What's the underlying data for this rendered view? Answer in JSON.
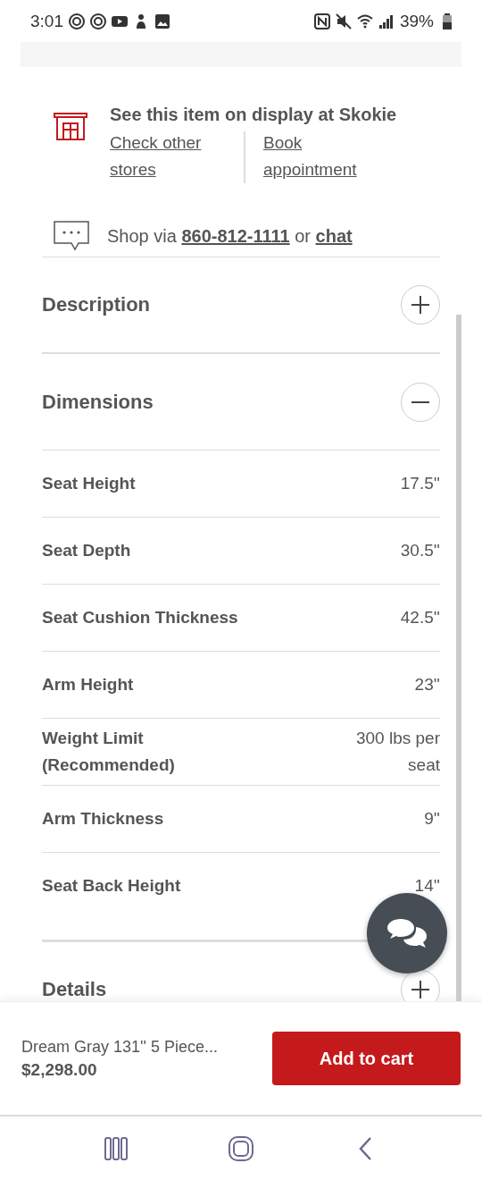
{
  "status_bar": {
    "time": "3:01",
    "battery": "39%"
  },
  "store": {
    "title": "See this item on display at Skokie",
    "links": [
      "Check other stores",
      "Book appointment"
    ]
  },
  "contact": {
    "prefix": "Shop via",
    "phone": "860-812-1111",
    "joiner": "or",
    "chat": "chat"
  },
  "sections": [
    {
      "title": "Description",
      "expanded": false
    },
    {
      "title": "Dimensions",
      "expanded": true,
      "rows": [
        {
          "label": "Seat Height",
          "value": "17.5''"
        },
        {
          "label": "Seat Depth",
          "value": "30.5''"
        },
        {
          "label": "Seat Cushion Thickness",
          "value": "42.5''"
        },
        {
          "label": "Arm Height",
          "value": "23''"
        },
        {
          "label": "Weight Limit (Recommended)",
          "value": "300 lbs per seat"
        },
        {
          "label": "Arm Thickness",
          "value": "9''"
        },
        {
          "label": "Seat Back Height",
          "value": "14''"
        }
      ]
    },
    {
      "title": "Details",
      "expanded": false
    }
  ],
  "purchase_bar": {
    "product": "Dream Gray 131'' 5 Piece...",
    "price": "$2,298.00",
    "button": "Add to cart"
  }
}
